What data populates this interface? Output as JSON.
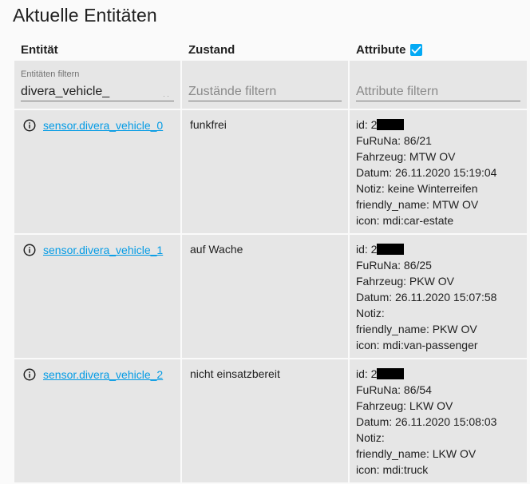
{
  "page": {
    "title": "Aktuelle Entitäten"
  },
  "table": {
    "headers": {
      "entity": "Entität",
      "state": "Zustand",
      "attributes": "Attribute"
    },
    "attributes_checkbox_checked": true,
    "filters": {
      "entity_label": "Entitäten filtern",
      "entity_value": "divera_vehicle_",
      "state_placeholder": "Zustände filtern",
      "attributes_placeholder": "Attribute filtern"
    },
    "rows": [
      {
        "entity_id": "sensor.divera_vehicle_0",
        "state": "funkfrei",
        "attributes": {
          "id": "id: 2",
          "furuna": "FuRuNa: 86/21",
          "fahrzeug": "Fahrzeug: MTW OV",
          "datum": "Datum: 26.11.2020 15:19:04",
          "notiz": "Notiz: keine Winterreifen",
          "friendly_name": "friendly_name: MTW OV",
          "icon": "icon: mdi:car-estate"
        }
      },
      {
        "entity_id": "sensor.divera_vehicle_1",
        "state": "auf Wache",
        "attributes": {
          "id": "id: 2",
          "furuna": "FuRuNa: 86/25",
          "fahrzeug": "Fahrzeug: PKW OV",
          "datum": "Datum: 26.11.2020 15:07:58",
          "notiz": "Notiz:",
          "friendly_name": "friendly_name: PKW OV",
          "icon": "icon: mdi:van-passenger"
        }
      },
      {
        "entity_id": "sensor.divera_vehicle_2",
        "state": "nicht einsatzbereit",
        "attributes": {
          "id": "id: 2",
          "furuna": "FuRuNa: 86/54",
          "fahrzeug": "Fahrzeug: LKW OV",
          "datum": "Datum: 26.11.2020 15:08:03",
          "notiz": "Notiz:",
          "friendly_name": "friendly_name: LKW OV",
          "icon": "icon: mdi:truck"
        }
      }
    ]
  },
  "icons": {
    "info": "information-outline-icon",
    "checkbox": "checkbox-checked-icon"
  },
  "colors": {
    "accent": "#03a9f4",
    "link": "#039be5",
    "cell_bg": "#e6e6e6",
    "page_bg": "#fafafa"
  }
}
